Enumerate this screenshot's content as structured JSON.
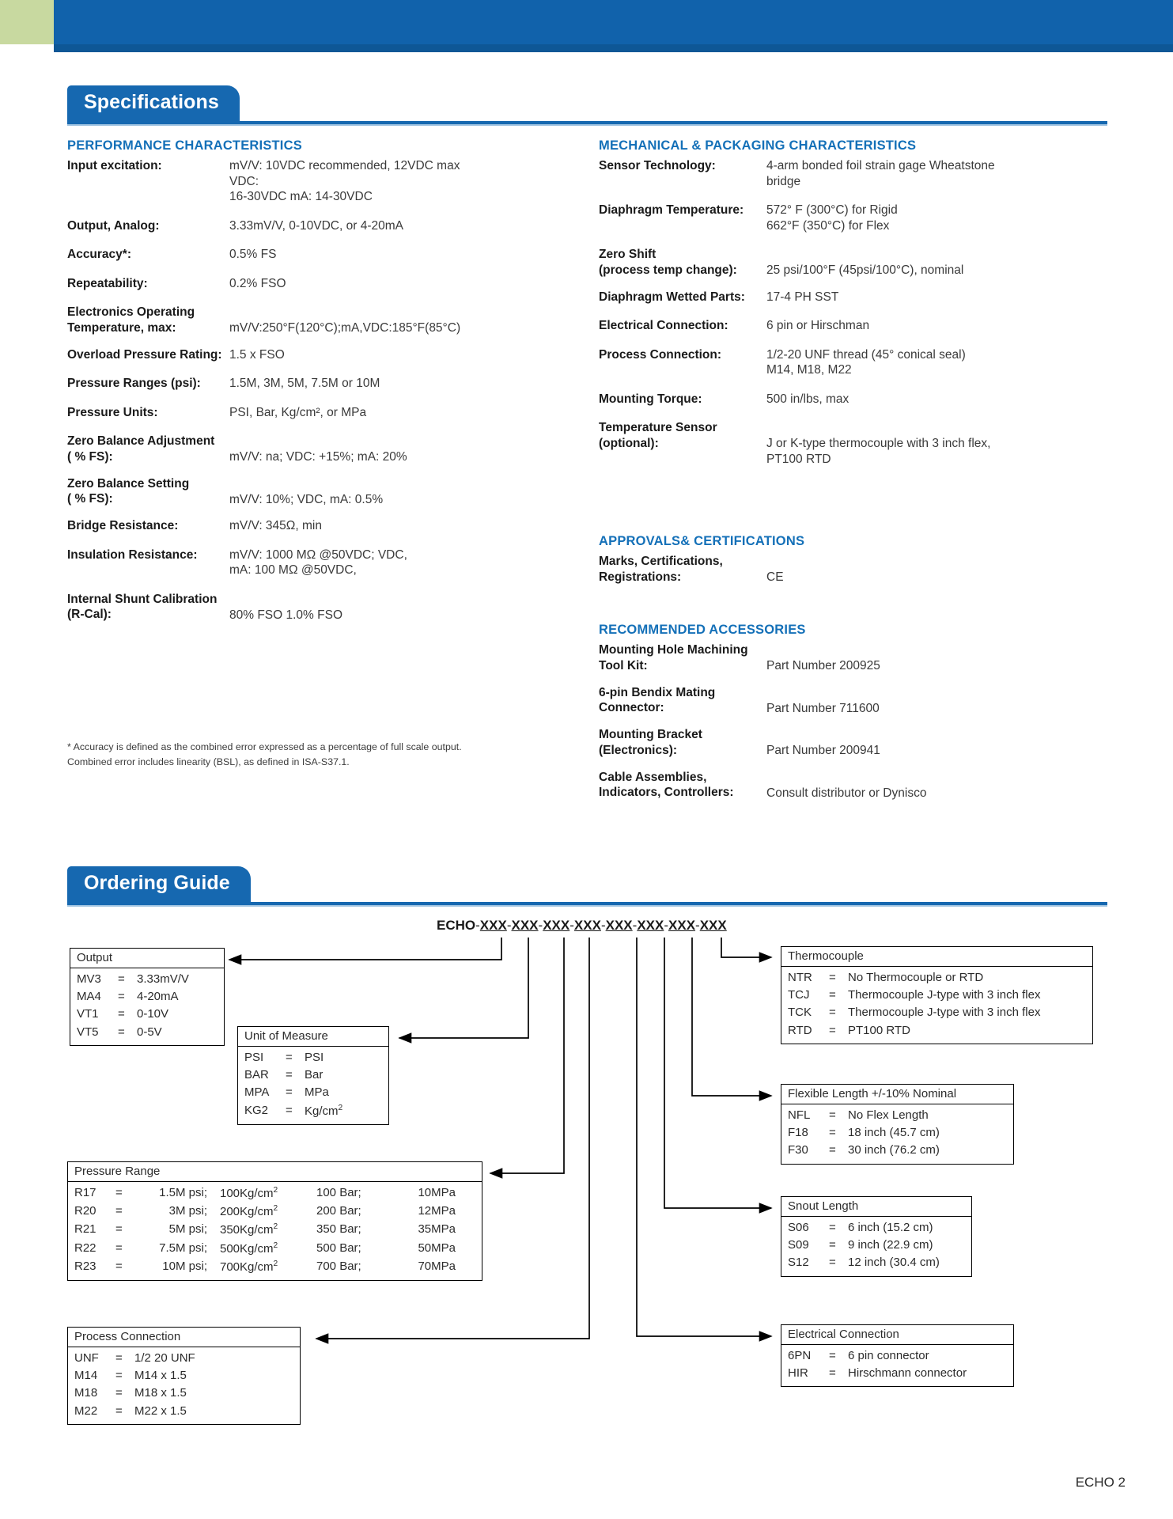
{
  "colors": {
    "brand_blue": "#1668b0",
    "header_blue": "#1162ab",
    "heading_blue": "#1470b8",
    "green_block": "#c8d9a0"
  },
  "sections": {
    "specifications": {
      "title": "Specifications"
    },
    "ordering_guide": {
      "title": "Ordering Guide"
    }
  },
  "performance": {
    "heading": "PERFORMANCE CHARACTERISTICS",
    "rows": [
      {
        "label": "Input excitation:",
        "value": "mV/V: 10VDC recommended, 12VDC max VDC:\n16-30VDC mA: 14-30VDC"
      },
      {
        "label": "Output, Analog:",
        "value": "3.33mV/V, 0-10VDC, or 4-20mA"
      },
      {
        "label": "Accuracy*:",
        "value": "0.5% FS",
        "pm": true
      },
      {
        "label": "Repeatability:",
        "value": "0.2% FSO",
        "pm": true
      },
      {
        "label": "Electronics Operating\nTemperature, max:",
        "value": "mV/V:250°F(120°C);mA,VDC:185°F(85°C)"
      },
      {
        "label": "Overload Pressure Rating:",
        "value": "1.5 x FSO"
      },
      {
        "label": "Pressure Ranges (psi):",
        "value": "1.5M, 3M, 5M, 7.5M or 10M"
      },
      {
        "label": "Pressure Units:",
        "value": "PSI, Bar, Kg/cm², or MPa"
      },
      {
        "label": "Zero Balance Adjustment\n(  % FS):",
        "value": "mV/V: na; VDC: +15%; mA:   20%"
      },
      {
        "label": "Zero Balance Setting\n(  % FS):",
        "value": "mV/V:   10%; VDC, mA:   0.5%"
      },
      {
        "label": "Bridge Resistance:",
        "value": "mV/V: 345Ω, min"
      },
      {
        "label": "Insulation Resistance:",
        "value": "mV/V: 1000 MΩ @50VDC; VDC,\nmA: 100 MΩ @50VDC,"
      },
      {
        "label": "Internal Shunt Calibration\n(R-Cal):",
        "value": "80% FSO   1.0% FSO"
      }
    ],
    "footnote": "* Accuracy is defined as the combined error expressed as a percentage of full scale output.\n   Combined error includes linearity (BSL), as defined in ISA-S37.1."
  },
  "mechanical": {
    "heading": "MECHANICAL & PACKAGING CHARACTERISTICS",
    "rows": [
      {
        "label": "Sensor Technology:",
        "value": "4-arm bonded foil strain gage Wheatstone\nbridge"
      },
      {
        "label": "Diaphragm Temperature:",
        "value": "572° F (300°C) for Rigid\n662°F (350°C) for Flex"
      },
      {
        "label": "Zero Shift\n(process temp change):",
        "value": "25 psi/100°F (45psi/100°C), nominal"
      },
      {
        "label": "Diaphragm Wetted Parts:",
        "value": "17-4 PH SST"
      },
      {
        "label": "Electrical Connection:",
        "value": " 6 pin or Hirschman"
      },
      {
        "label": "Process Connection:",
        "value": "1/2-20 UNF thread (45° conical seal)\nM14, M18, M22"
      },
      {
        "label": "Mounting Torque:",
        "value": "500 in/lbs, max"
      },
      {
        "label": "Temperature Sensor\n(optional):",
        "value": "J or K-type thermocouple with 3 inch flex,\nPT100 RTD"
      }
    ]
  },
  "approvals": {
    "heading": "APPROVALS& CERTIFICATIONS",
    "rows": [
      {
        "label": "Marks, Certifications,\nRegistrations:",
        "value": "CE"
      }
    ]
  },
  "accessories": {
    "heading": "RECOMMENDED ACCESSORIES",
    "rows": [
      {
        "label": "Mounting Hole Machining\nTool Kit:",
        "value": "Part Number 200925"
      },
      {
        "label": "6-pin Bendix Mating\nConnector:",
        "value": "Part Number 711600"
      },
      {
        "label": "Mounting Bracket\n(Electronics):",
        "value": "Part Number 200941"
      },
      {
        "label": "Cable Assemblies,\nIndicators, Controllers:",
        "value": "Consult distributor or Dynisco"
      }
    ]
  },
  "ordering": {
    "part_prefix": "ECHO",
    "part_segments": [
      "XXX",
      "XXX",
      "XXX",
      "XXX",
      "XXX",
      "XXX",
      "XXX",
      "XXX"
    ],
    "boxes": {
      "output": {
        "title": "Output",
        "rows": [
          {
            "code": "MV3",
            "eq": "=",
            "desc": "3.33mV/V"
          },
          {
            "code": "MA4",
            "eq": "=",
            "desc": "4-20mA"
          },
          {
            "code": "VT1",
            "eq": "=",
            "desc": "0-10V"
          },
          {
            "code": "VT5",
            "eq": "=",
            "desc": "0-5V"
          }
        ]
      },
      "unit_of_measure": {
        "title": "Unit of Measure",
        "rows": [
          {
            "code": "PSI",
            "eq": "=",
            "desc": "PSI"
          },
          {
            "code": "BAR",
            "eq": "=",
            "desc": "Bar"
          },
          {
            "code": "MPA",
            "eq": "=",
            "desc": "MPa"
          },
          {
            "code": "KG2",
            "eq": "=",
            "desc": "Kg/cm²"
          }
        ]
      },
      "pressure_range": {
        "title": "Pressure Range",
        "rows": [
          {
            "code": "R17",
            "eq": "=",
            "psi": "1.5M psi;",
            "kg": "100Kg/cm²",
            "bar": "100 Bar;",
            "mpa": "10MPa"
          },
          {
            "code": "R20",
            "eq": "=",
            "psi": "3M psi;",
            "kg": "200Kg/cm²",
            "bar": "200 Bar;",
            "mpa": "12MPa"
          },
          {
            "code": "R21",
            "eq": "=",
            "psi": "5M psi;",
            "kg": "350Kg/cm²",
            "bar": "350 Bar;",
            "mpa": "35MPa"
          },
          {
            "code": "R22",
            "eq": "=",
            "psi": "7.5M psi;",
            "kg": "500Kg/cm²",
            "bar": "500 Bar;",
            "mpa": "50MPa"
          },
          {
            "code": "R23",
            "eq": "=",
            "psi": "10M psi;",
            "kg": "700Kg/cm²",
            "bar": "700 Bar;",
            "mpa": "70MPa"
          }
        ]
      },
      "process_connection": {
        "title": "Process Connection",
        "rows": [
          {
            "code": "UNF",
            "eq": "=",
            "desc": "1/2 20 UNF"
          },
          {
            "code": "M14",
            "eq": "=",
            "desc": "M14 x 1.5"
          },
          {
            "code": "M18",
            "eq": "=",
            "desc": "M18 x 1.5"
          },
          {
            "code": "M22",
            "eq": "=",
            "desc": "M22 x 1.5"
          }
        ]
      },
      "thermocouple": {
        "title": "Thermocouple",
        "rows": [
          {
            "code": "NTR",
            "eq": "=",
            "desc": "No Thermocouple or RTD"
          },
          {
            "code": "TCJ",
            "eq": "=",
            "desc": "Thermocouple J-type with 3 inch flex"
          },
          {
            "code": "TCK",
            "eq": "=",
            "desc": "Thermocouple J-type with 3 inch flex"
          },
          {
            "code": "RTD",
            "eq": "=",
            "desc": "PT100 RTD"
          }
        ]
      },
      "flexible_length": {
        "title": "Flexible Length +/-10% Nominal",
        "rows": [
          {
            "code": "NFL",
            "eq": "=",
            "desc": "No Flex Length"
          },
          {
            "code": "F18",
            "eq": "=",
            "desc": "18 inch (45.7 cm)"
          },
          {
            "code": "F30",
            "eq": "=",
            "desc": "30 inch (76.2 cm)"
          }
        ]
      },
      "snout_length": {
        "title": "Snout Length",
        "rows": [
          {
            "code": "S06",
            "eq": "=",
            "desc": "6 inch (15.2 cm)"
          },
          {
            "code": "S09",
            "eq": "=",
            "desc": "9 inch (22.9 cm)"
          },
          {
            "code": "S12",
            "eq": "=",
            "desc": "12 inch (30.4 cm)"
          }
        ]
      },
      "electrical_connection": {
        "title": "Electrical Connection",
        "rows": [
          {
            "code": "6PN",
            "eq": "=",
            "desc": "6 pin connector"
          },
          {
            "code": "HIR",
            "eq": "=",
            "desc": "Hirschmann connector"
          }
        ]
      }
    }
  },
  "page_footer": "ECHO 2"
}
